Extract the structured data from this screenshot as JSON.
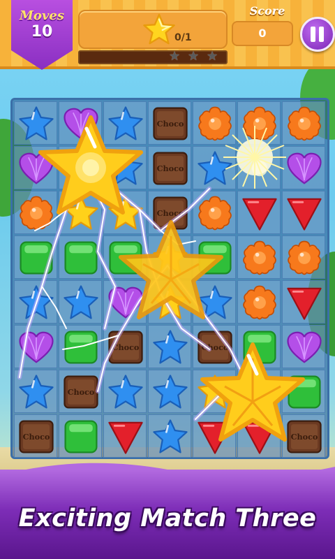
{
  "hud": {
    "moves_label": "Moves",
    "moves_value": "10",
    "target_count": "0/1",
    "score_label": "Score",
    "score_value": "0",
    "stars_total": 3,
    "stars_earned": 0,
    "progress_fraction": 0.0
  },
  "board": {
    "columns": 7,
    "rows": 8,
    "rows_data": [
      [
        "blue-star",
        "purple-heart",
        "blue-star",
        "choco",
        "orange-flower",
        "orange-flower",
        "orange-flower"
      ],
      [
        "purple-heart",
        "yellow-star",
        "blue-star",
        "choco",
        "blue-star",
        "spark",
        "purple-heart"
      ],
      [
        "orange-flower",
        "yellow-star",
        "yellow-star",
        "choco",
        "orange-flower",
        "red-triangle",
        "red-triangle"
      ],
      [
        "green-square",
        "green-square",
        "green-square",
        "yellow-star",
        "green-square",
        "orange-flower",
        "orange-flower"
      ],
      [
        "blue-star",
        "blue-star",
        "purple-heart",
        "yellow-star",
        "blue-star",
        "orange-flower",
        "red-triangle"
      ],
      [
        "purple-heart",
        "green-square",
        "choco",
        "blue-star",
        "choco",
        "green-square",
        "purple-heart"
      ],
      [
        "blue-star",
        "choco",
        "blue-star",
        "blue-star",
        "yellow-star",
        "yellow-star",
        "green-square"
      ],
      [
        "choco",
        "green-square",
        "red-triangle",
        "blue-star",
        "red-triangle",
        "red-triangle",
        "choco"
      ]
    ],
    "choco_label": "Choco"
  },
  "banner": {
    "text": "Exciting Match Three"
  },
  "icons": {
    "target": "star-candy-icon",
    "pause": "pause-icon",
    "progress_star": "star-icon"
  },
  "colors": {
    "blue": "#2f8ff0",
    "purple": "#b44fe8",
    "orange": "#f7791c",
    "green": "#2fbf3a",
    "red": "#e3202b",
    "choco": "#6b3a22",
    "yellow": "#ffd11a",
    "banner": "#7d2db7"
  }
}
